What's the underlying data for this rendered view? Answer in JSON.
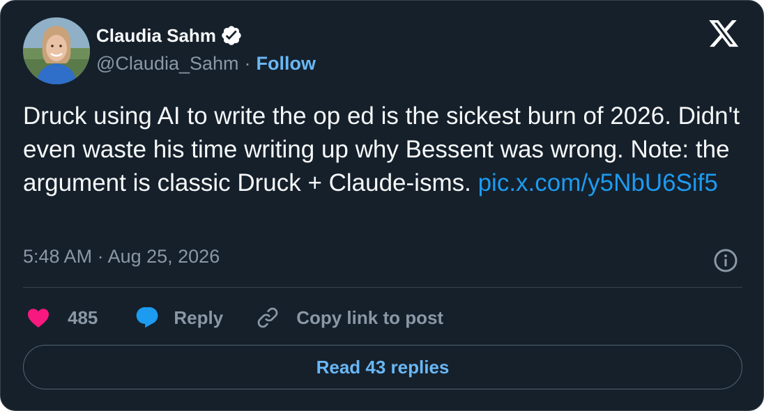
{
  "author": {
    "display_name": "Claudia Sahm",
    "handle": "@Claudia_Sahm",
    "separator": "·",
    "follow_label": "Follow",
    "verified_icon": "verified-badge-icon"
  },
  "platform_logo": "x-logo-icon",
  "tweet": {
    "text": "Druck using AI to write the op ed is the sickest burn of 2026. Didn't even waste his time writing up why Bessent was wrong. Note: the argument is classic Druck + Claude-isms.",
    "link": "pic.x.com/y5NbU6Sif5"
  },
  "timestamp": "5:48 AM · Aug 25, 2026",
  "actions": {
    "likes_count": "485",
    "reply_label": "Reply",
    "copy_link_label": "Copy link to post"
  },
  "read_replies_label": "Read 43 replies",
  "colors": {
    "background": "#15202b",
    "accent": "#1d9bf0",
    "like": "#f91880",
    "muted": "#8b98a5"
  }
}
